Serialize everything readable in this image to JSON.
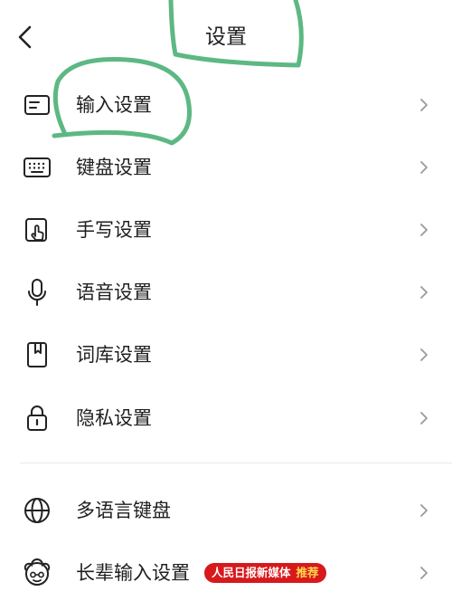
{
  "header": {
    "title": "设置",
    "back_icon": "chevron-left-icon"
  },
  "groups": [
    {
      "items": [
        {
          "label": "输入设置",
          "icon": "input-box-icon"
        },
        {
          "label": "键盘设置",
          "icon": "keyboard-icon"
        },
        {
          "label": "手写设置",
          "icon": "handwriting-icon"
        },
        {
          "label": "语音设置",
          "icon": "microphone-icon"
        },
        {
          "label": "词库设置",
          "icon": "dictionary-book-icon"
        },
        {
          "label": "隐私设置",
          "icon": "lock-icon"
        }
      ]
    },
    {
      "items": [
        {
          "label": "多语言键盘",
          "icon": "globe-icon"
        },
        {
          "label": "长辈输入设置",
          "icon": "elder-face-icon",
          "badge": {
            "text": "人民日报新媒体",
            "tag": "推荐"
          }
        }
      ]
    }
  ],
  "colors": {
    "annotation": "#5db883",
    "badge_bg": "#d7191c",
    "badge_tag": "#ffd84a",
    "chevron": "#9a9a9a"
  }
}
